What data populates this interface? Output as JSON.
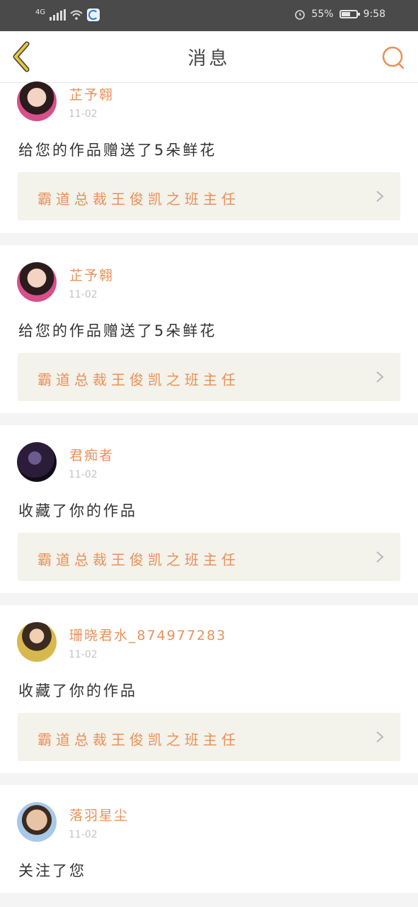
{
  "status_bar": {
    "network": "4G",
    "battery_percent": "55%",
    "battery_level": 0.55,
    "time": "9:58",
    "icons": [
      "signal-icon",
      "wifi-icon",
      "app-notification-icon",
      "alarm-icon",
      "battery-icon"
    ]
  },
  "header": {
    "title": "消息",
    "accent_color": "#e8915a",
    "back_icon_color": "#e8c53a"
  },
  "messages": [
    {
      "user": "芷予翱",
      "date": "11-02",
      "text": "给您的作品赠送了5朵鲜花",
      "work": "霸道总裁王俊凯之班主任"
    },
    {
      "user": "芷予翱",
      "date": "11-02",
      "text": "给您的作品赠送了5朵鲜花",
      "work": "霸道总裁王俊凯之班主任"
    },
    {
      "user": "君痴者",
      "date": "11-02",
      "text": "收藏了你的作品",
      "work": "霸道总裁王俊凯之班主任"
    },
    {
      "user": "珊晓君水_874977283",
      "date": "11-02",
      "text": "收藏了你的作品",
      "work": "霸道总裁王俊凯之班主任"
    },
    {
      "user": "落羽星尘",
      "date": "11-02",
      "text": "关注了您",
      "work": ""
    }
  ]
}
